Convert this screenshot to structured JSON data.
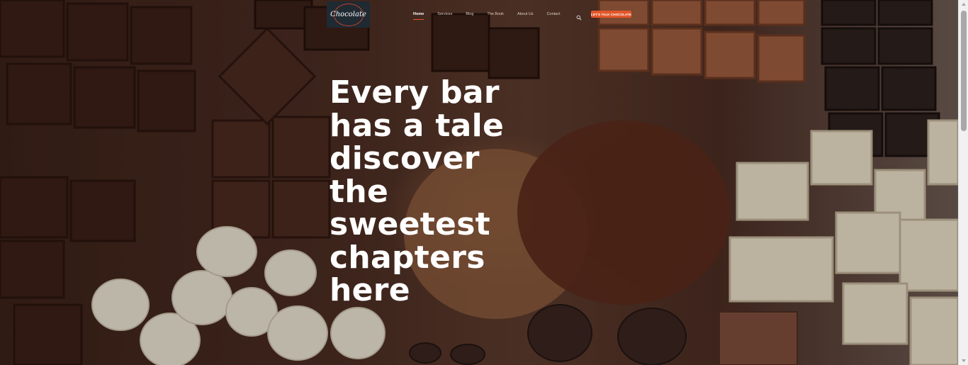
{
  "header": {
    "logo_text": "Chocolate",
    "nav": [
      {
        "label": "Home",
        "active": true
      },
      {
        "label": "Services",
        "active": false
      },
      {
        "label": "Blog",
        "active": false
      },
      {
        "label": "The Book",
        "active": false
      },
      {
        "label": "About Us",
        "active": false
      },
      {
        "label": "Contact",
        "active": false
      }
    ],
    "search_icon": "search-icon",
    "cta_label": "LET'S TALK CHOCOLATE"
  },
  "hero": {
    "headline_lines": [
      "Every bar",
      "has a tale",
      "discover",
      "the",
      "sweetest",
      "chapters",
      "here"
    ]
  },
  "colors": {
    "accent": "#e2562a",
    "logo_bg": "#1f2a33",
    "headline": "#ffffff"
  }
}
